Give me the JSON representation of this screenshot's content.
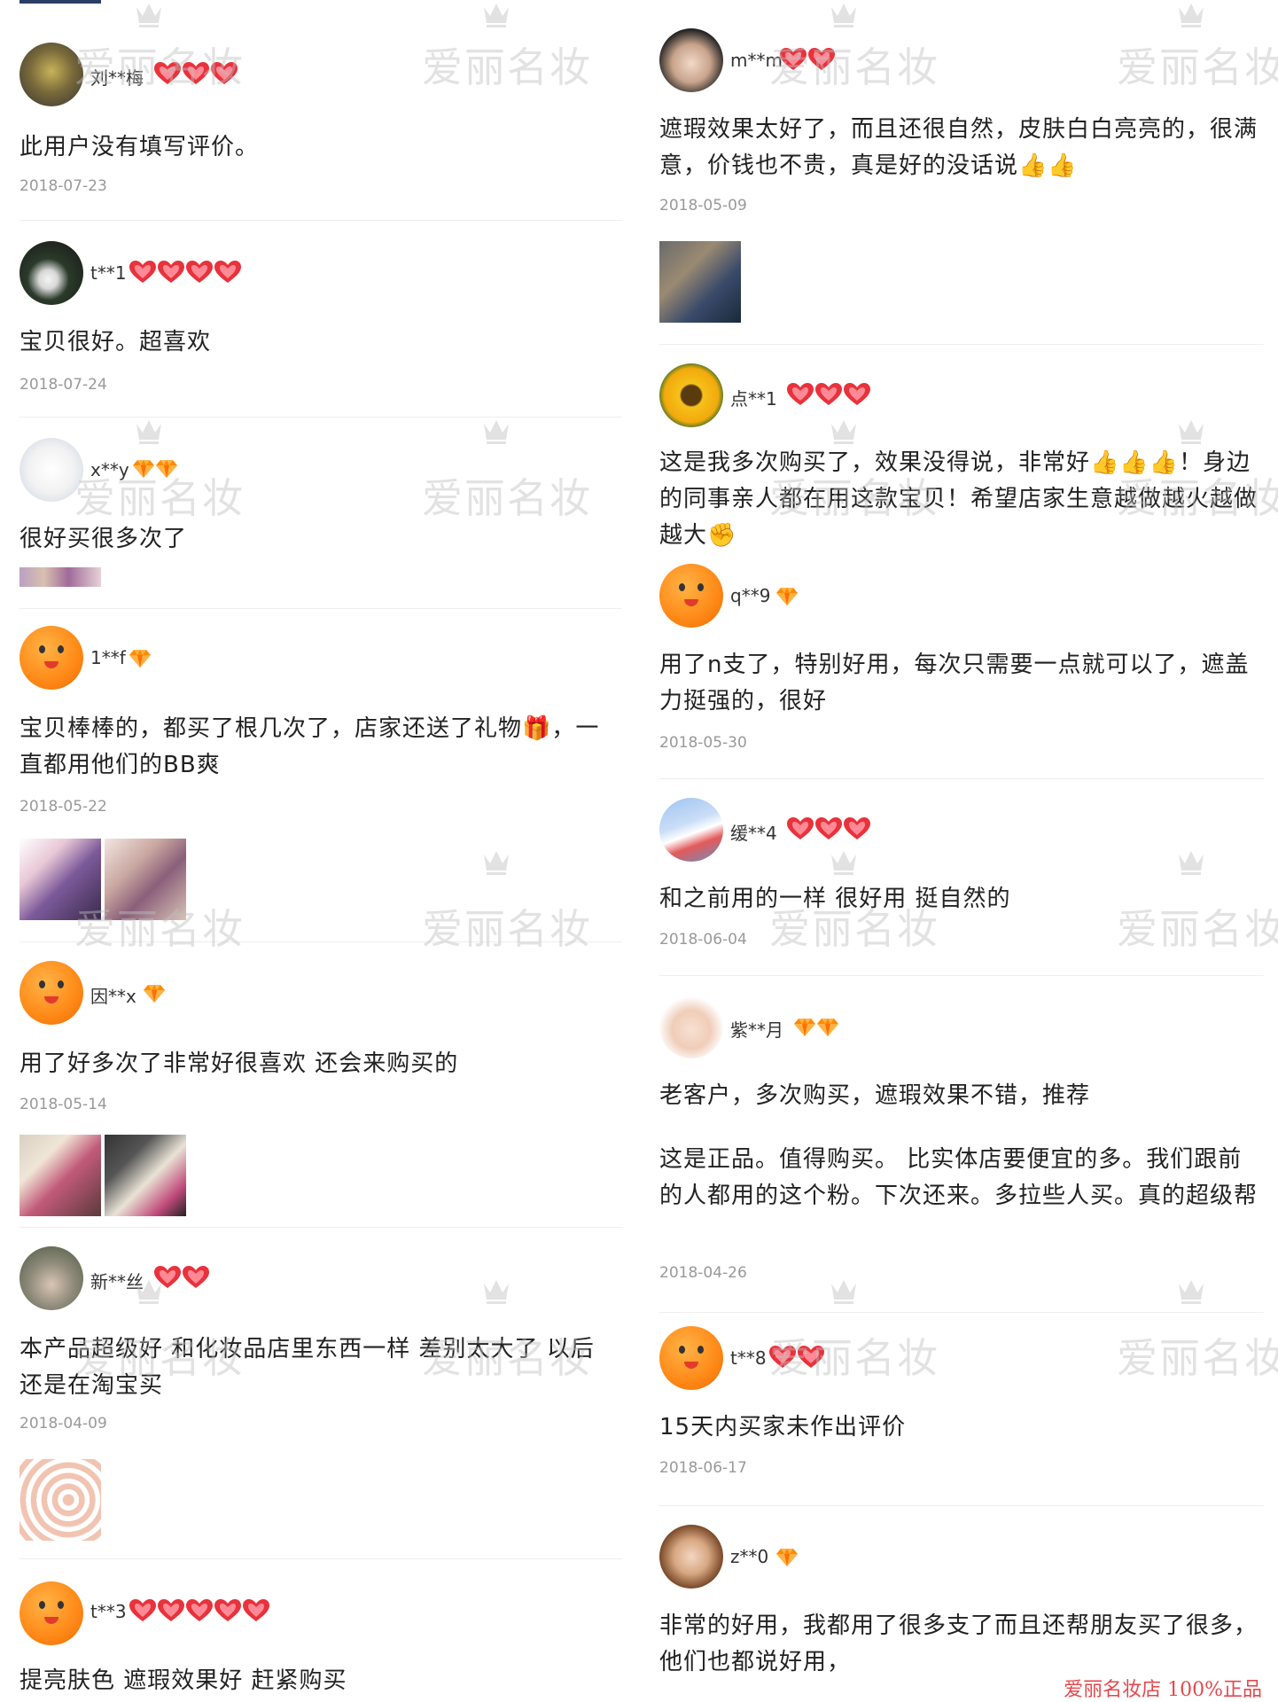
{
  "left_reviews": [
    {
      "user": "刘**梅",
      "avatar": "cake",
      "badge": "heart",
      "badge_count": 3,
      "text": "此用户没有填写评价。",
      "date": "2018-07-23"
    },
    {
      "user": "t**1",
      "avatar": "dark",
      "badge": "heart",
      "badge_count": 4,
      "text": "宝贝很好。超喜欢",
      "date": "2018-07-24"
    },
    {
      "user": "x**y",
      "avatar": "dog",
      "badge": "gem",
      "badge_count": 2,
      "text": "很好买很多次了",
      "date": ""
    },
    {
      "user": "1**f",
      "avatar": "orange",
      "badge": "gem",
      "badge_count": 1,
      "text": "宝贝棒棒的，都买了根几次了，店家还送了礼物🎁，一直都用他们的BB爽",
      "date": "2018-05-22"
    },
    {
      "user": "因**x",
      "avatar": "orange",
      "badge": "gem",
      "badge_count": 1,
      "text": "用了好多次了非常好很喜欢 还会来购买的",
      "date": "2018-05-14"
    },
    {
      "user": "新**丝",
      "avatar": "photo1",
      "badge": "heart",
      "badge_count": 2,
      "text": "本产品超级好 和化妆品店里东西一样 差别太大了 以后还是在淘宝买",
      "date": "2018-04-09"
    },
    {
      "user": "t**3",
      "avatar": "orange",
      "badge": "heart",
      "badge_count": 5,
      "text": "提亮肤色 遮瑕效果好 赶紧购买",
      "date": ""
    }
  ],
  "right_reviews": [
    {
      "user": "m**m",
      "avatar": "girl1",
      "badge": "heart",
      "badge_count": 2,
      "text": "遮瑕效果太好了，而且还很自然，皮肤白白亮亮的，很满意，价钱也不贵，真是好的没话说👍👍",
      "date": "2018-05-09"
    },
    {
      "user": "点**1",
      "avatar": "sun",
      "badge": "heart",
      "badge_count": 3,
      "text": "这是我多次购买了，效果没得说，非常好👍👍👍！身边的同事亲人都在用这款宝贝！希望店家生意越做越火越做越大✊",
      "date": ""
    },
    {
      "user": "q**9",
      "avatar": "orange",
      "badge": "gem",
      "badge_count": 1,
      "text": "用了n支了，特别好用，每次只需要一点就可以了，遮盖力挺强的，很好",
      "date": "2018-05-30"
    },
    {
      "user": "缓**4",
      "avatar": "sky",
      "badge": "heart",
      "badge_count": 3,
      "text": "和之前用的一样 很好用 挺自然的",
      "date": "2018-06-04"
    },
    {
      "user": "紫**月",
      "avatar": "girl2",
      "badge": "gem",
      "badge_count": 2,
      "text": "老客户，多次购买，遮瑕效果不错，推荐",
      "date": ""
    },
    {
      "user": "",
      "avatar": "",
      "badge": "",
      "badge_count": 0,
      "text": "这是正品。值得购买。 比实体店要便宜的多。我们跟前的人都用的这个粉。下次还来。多拉些人买。真的超级帮",
      "date": "2018-04-26"
    },
    {
      "user": "t**8",
      "avatar": "orange",
      "badge": "heart",
      "badge_count": 2,
      "text": "15天内买家未作出评价",
      "date": "2018-06-17"
    },
    {
      "user": "z**0",
      "avatar": "girl3",
      "badge": "gem",
      "badge_count": 1,
      "text": "非常的好用，我都用了很多支了而且还帮朋友买了很多，他们也都说好用，",
      "date": ""
    }
  ],
  "watermark": {
    "text": "爱丽名妆",
    "footer": "爱丽名妆店 100%正品"
  },
  "colors": {
    "heart": "#e8323c",
    "gem": "#ff8a00",
    "watermark": "#bebebe",
    "footer": "#e5484d"
  }
}
